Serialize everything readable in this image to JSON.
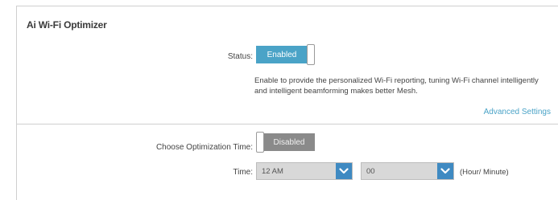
{
  "section": {
    "title": "Ai Wi-Fi Optimizer"
  },
  "status": {
    "label": "Status:",
    "toggle_label": "Enabled",
    "toggle_state": "on",
    "description": "Enable to provide the personalized Wi-Fi reporting, tuning Wi-Fi channel intelligently and intelligent beamforming makes better Mesh."
  },
  "advanced": {
    "link_label": "Advanced Settings"
  },
  "optimization": {
    "label": "Choose Optimization Time:",
    "toggle_label": "Disabled",
    "toggle_state": "off"
  },
  "time": {
    "label": "Time:",
    "hour_value": "12 AM",
    "minute_value": "00",
    "unit_label": "(Hour/ Minute)"
  },
  "colors": {
    "accent": "#4aa3c7",
    "dropdown_button": "#3f8ac2",
    "disabled_toggle": "#8a8a8a"
  },
  "icons": {
    "dropdown": "chevron-down-icon"
  }
}
